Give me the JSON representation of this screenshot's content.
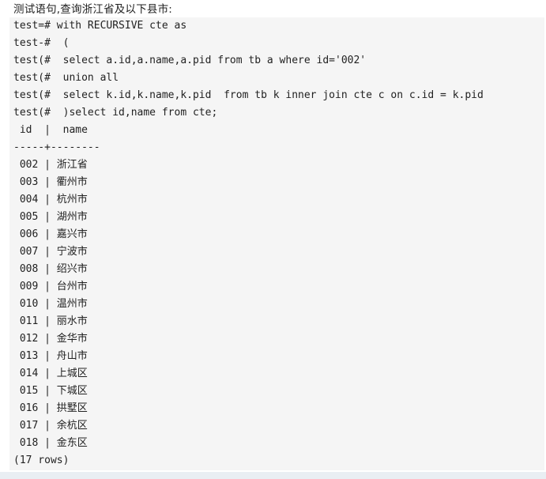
{
  "caption": "测试语句,查询浙江省及以下县市:",
  "query_lines": [
    "test=# with RECURSIVE cte as",
    "test-#  (",
    "test(#  select a.id,a.name,a.pid from tb a where id='002'",
    "test(#  union all",
    "test(#  select k.id,k.name,k.pid  from tb k inner join cte c on c.id = k.pid",
    "test(#  )select id,name from cte;"
  ],
  "table_header": " id  |  name",
  "table_divider": "-----+--------",
  "rows": [
    {
      "id": "002",
      "name": "浙江省"
    },
    {
      "id": "003",
      "name": "衢州市"
    },
    {
      "id": "004",
      "name": "杭州市"
    },
    {
      "id": "005",
      "name": "湖州市"
    },
    {
      "id": "006",
      "name": "嘉兴市"
    },
    {
      "id": "007",
      "name": "宁波市"
    },
    {
      "id": "008",
      "name": "绍兴市"
    },
    {
      "id": "009",
      "name": "台州市"
    },
    {
      "id": "010",
      "name": "温州市"
    },
    {
      "id": "011",
      "name": "丽水市"
    },
    {
      "id": "012",
      "name": "金华市"
    },
    {
      "id": "013",
      "name": "舟山市"
    },
    {
      "id": "014",
      "name": "上城区"
    },
    {
      "id": "015",
      "name": "下城区"
    },
    {
      "id": "016",
      "name": "拱墅区"
    },
    {
      "id": "017",
      "name": "余杭区"
    },
    {
      "id": "018",
      "name": "金东区"
    }
  ],
  "row_count": "(17 rows)"
}
